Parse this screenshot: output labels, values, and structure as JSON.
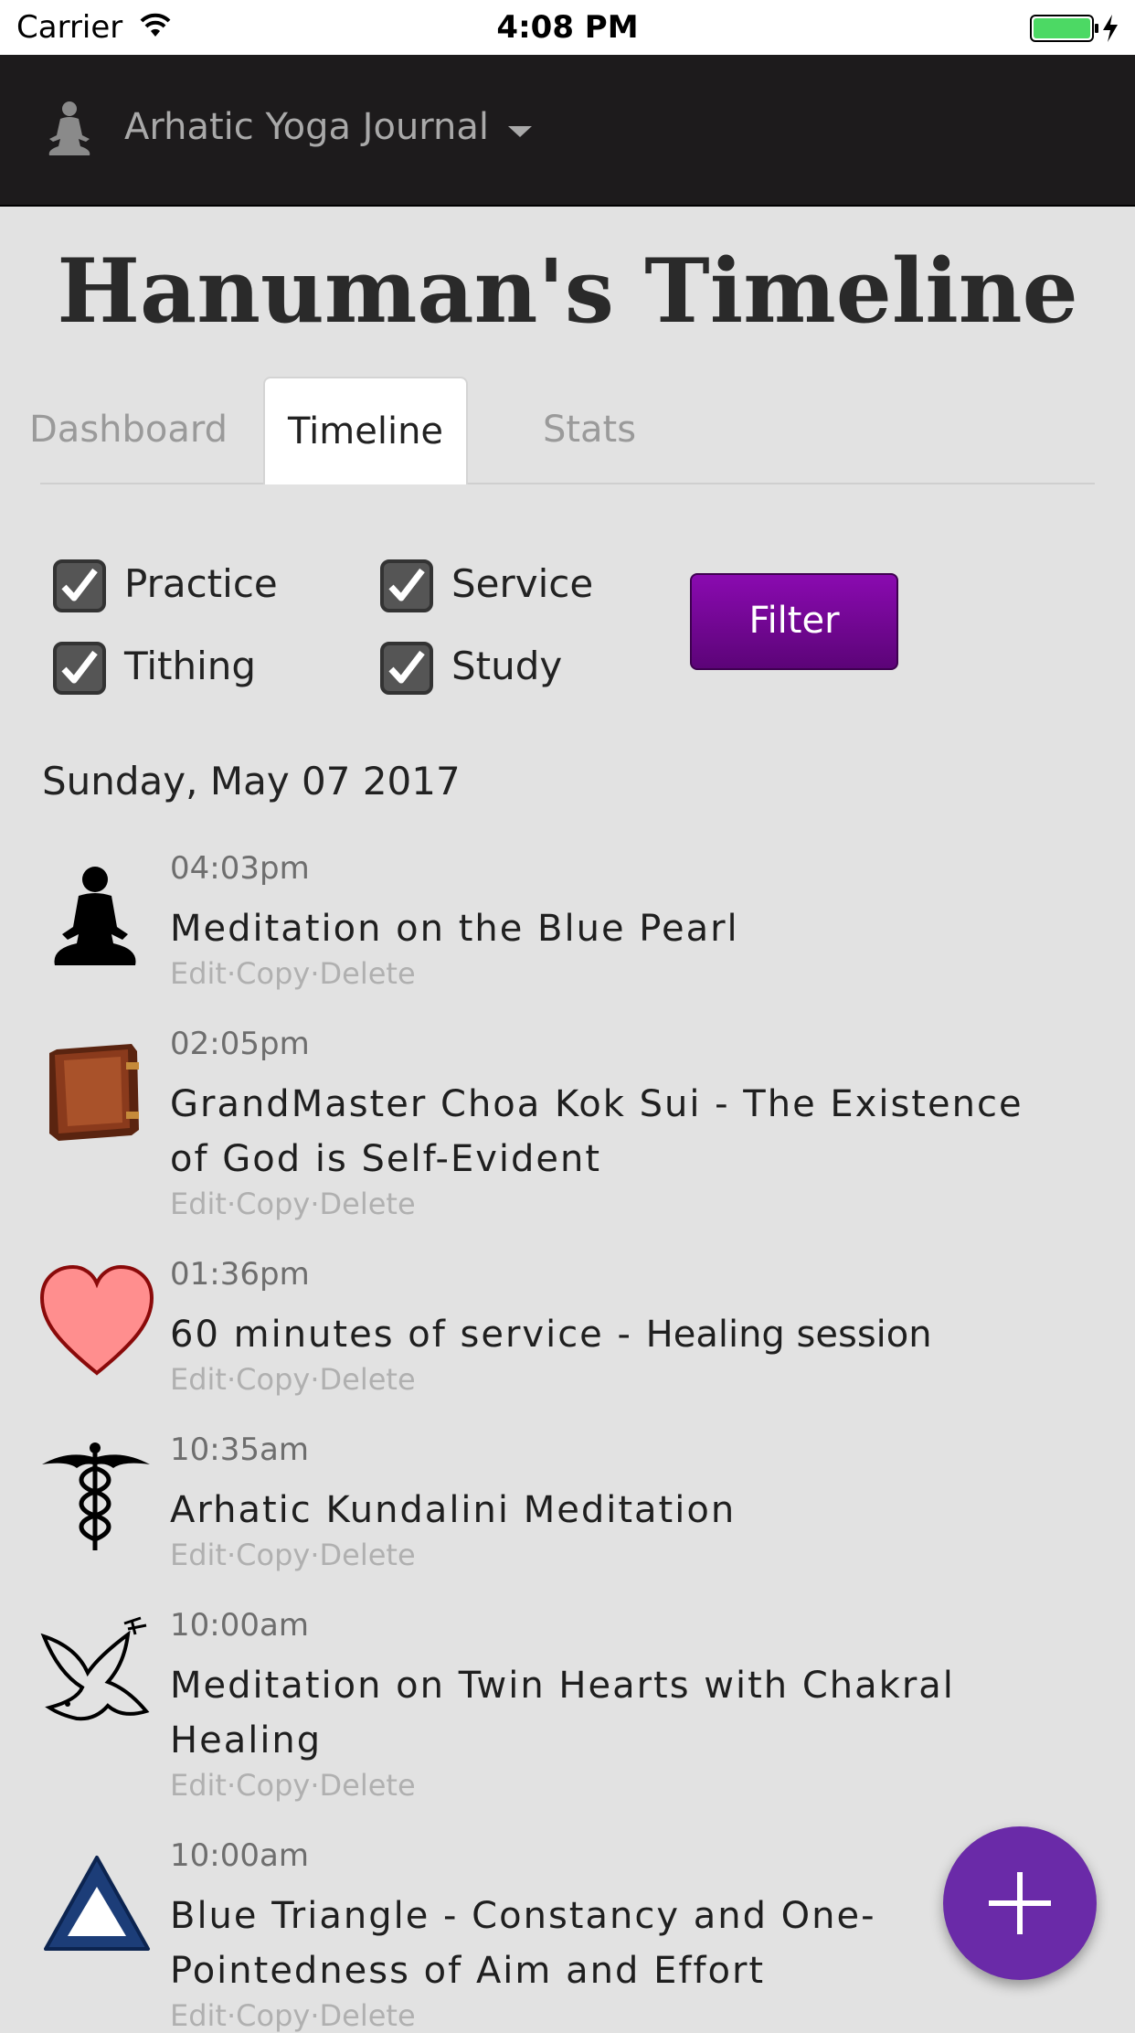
{
  "status_bar": {
    "carrier": "Carrier",
    "time": "4:08 PM",
    "battery_color": "#4cd964"
  },
  "nav": {
    "brand": "Arhatic Yoga Journal",
    "logo_icon": "meditating-figure-icon",
    "caret_icon": "caret-down-icon",
    "background": "#1d1b1c"
  },
  "page": {
    "title": "Hanuman's Timeline"
  },
  "tabs": [
    {
      "label": "Dashboard",
      "active": false
    },
    {
      "label": "Timeline",
      "active": true
    },
    {
      "label": "Stats",
      "active": false
    }
  ],
  "filters": {
    "checkboxes": [
      {
        "label": "Practice",
        "checked": true
      },
      {
        "label": "Service",
        "checked": true
      },
      {
        "label": "Tithing",
        "checked": true
      },
      {
        "label": "Study",
        "checked": true
      }
    ],
    "button_label": "Filter",
    "button_color": "#6e0890"
  },
  "timeline": {
    "date": "Sunday, May 07 2017",
    "entries": [
      {
        "time": "04:03pm",
        "title": "Meditation on the Blue Pearl",
        "subtitle": "",
        "icon": "meditation-silhouette-icon"
      },
      {
        "time": "02:05pm",
        "title": "GrandMaster Choa Kok Sui - The Existence of God is Self-Evident",
        "subtitle": "",
        "icon": "book-icon"
      },
      {
        "time": "01:36pm",
        "title": "60 minutes of service - ",
        "subtitle": "Healing session",
        "icon": "heart-icon"
      },
      {
        "time": "10:35am",
        "title": "Arhatic Kundalini Meditation",
        "subtitle": "",
        "icon": "caduceus-icon"
      },
      {
        "time": "10:00am",
        "title": "Meditation on Twin Hearts with Chakral Healing",
        "subtitle": "",
        "icon": "dove-icon"
      },
      {
        "time": "10:00am",
        "title": "Blue Triangle - Constancy and One-Pointedness of Aim and Effort",
        "subtitle": "",
        "icon": "blue-triangle-icon"
      }
    ],
    "actions": {
      "edit": "Edit",
      "copy": "Copy",
      "delete": "Delete",
      "separator": " · "
    }
  },
  "fab": {
    "icon": "plus-icon",
    "color": "#6a2aa8"
  }
}
